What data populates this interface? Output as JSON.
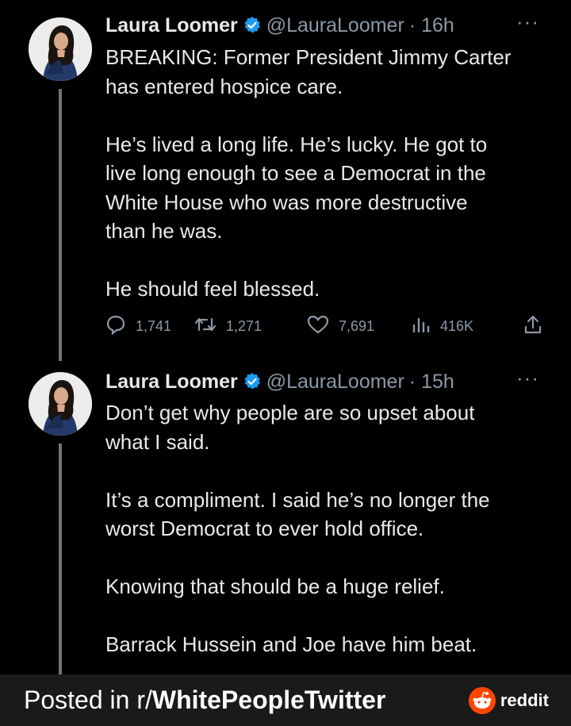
{
  "tweets": [
    {
      "name": "Laura Loomer",
      "handle": "@LauraLoomer",
      "time": "· 16h",
      "more": "···",
      "lines": [
        "BREAKING: Former President Jimmy Carter",
        "has entered hospice care.",
        "",
        "He’s lived a long life. He’s lucky. He got to",
        "live long enough to see a Democrat in the",
        "White House who was more destructive",
        "than he was.",
        "",
        "He should feel blessed."
      ],
      "replies": "1,741",
      "retweets": "1,271",
      "likes": "7,691",
      "views": "416K"
    },
    {
      "name": "Laura Loomer",
      "handle": "@LauraLoomer",
      "time": "· 15h",
      "more": "···",
      "lines": [
        "Don’t get why people are so upset about",
        "what I said.",
        "",
        "It’s a compliment. I said he’s no longer the",
        "worst Democrat to ever hold office.",
        "",
        "Knowing that should be a huge relief.",
        "",
        "Barrack Hussein and Joe have him beat."
      ]
    }
  ],
  "footer": {
    "prefix": "Posted in r/",
    "subreddit": "WhitePeopleTwitter",
    "brand": "reddit"
  },
  "icons": {
    "verified": "verified-badge-icon",
    "reply": "reply-icon",
    "retweet": "retweet-icon",
    "like": "heart-icon",
    "views": "views-icon",
    "share": "share-icon"
  },
  "colors": {
    "background": "#000000",
    "text": "#e7e9ea",
    "muted": "#8b98a5",
    "verified": "#1d9bf0",
    "reddit": "#ff4500"
  }
}
